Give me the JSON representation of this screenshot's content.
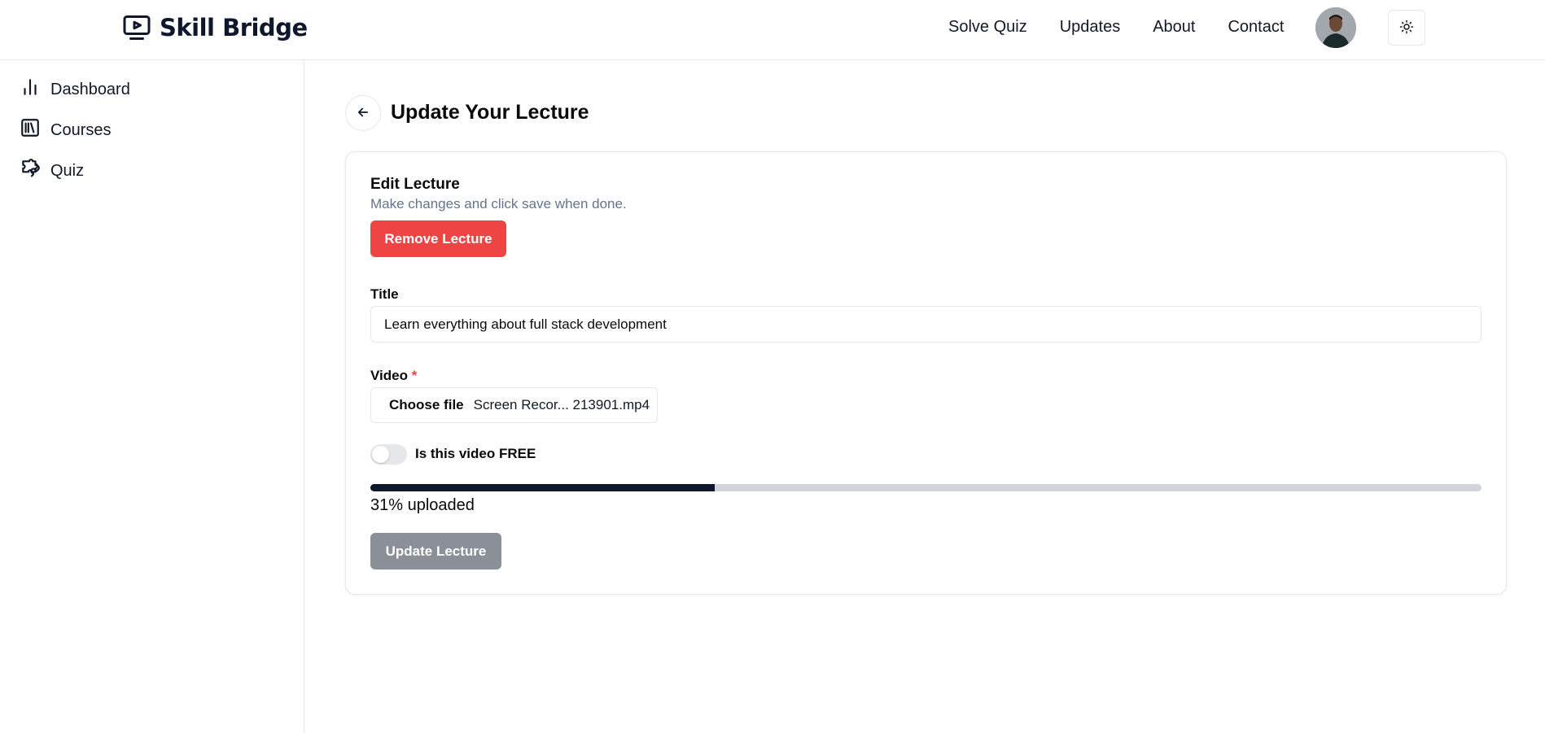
{
  "header": {
    "brand": "Skill Bridge",
    "brand_icon": "play-screen-icon",
    "nav": [
      "Solve Quiz",
      "Updates",
      "About",
      "Contact"
    ],
    "theme_icon": "sun-icon"
  },
  "sidebar": {
    "items": [
      {
        "label": "Dashboard",
        "icon": "bar-chart-icon"
      },
      {
        "label": "Courses",
        "icon": "library-icon"
      },
      {
        "label": "Quiz",
        "icon": "puzzle-icon"
      }
    ]
  },
  "main": {
    "title": "Update Your Lecture",
    "back_icon": "arrow-left-icon"
  },
  "form": {
    "heading": "Edit Lecture",
    "description": "Make changes and click save when done.",
    "remove_label": "Remove Lecture",
    "title_label": "Title",
    "title_value": "Learn everything about full stack development",
    "video_label": "Video",
    "required_mark": "*",
    "choose_file": "Choose file",
    "file_name": "Screen Recor... 213901.mp4",
    "free_label": "Is this video FREE",
    "free_checked": false,
    "progress_percent": 31,
    "progress_text": "31% uploaded",
    "update_label": "Update Lecture"
  },
  "colors": {
    "danger": "#ef4444",
    "progress_fill": "#0f172a",
    "disabled_button": "#8a8f98"
  }
}
